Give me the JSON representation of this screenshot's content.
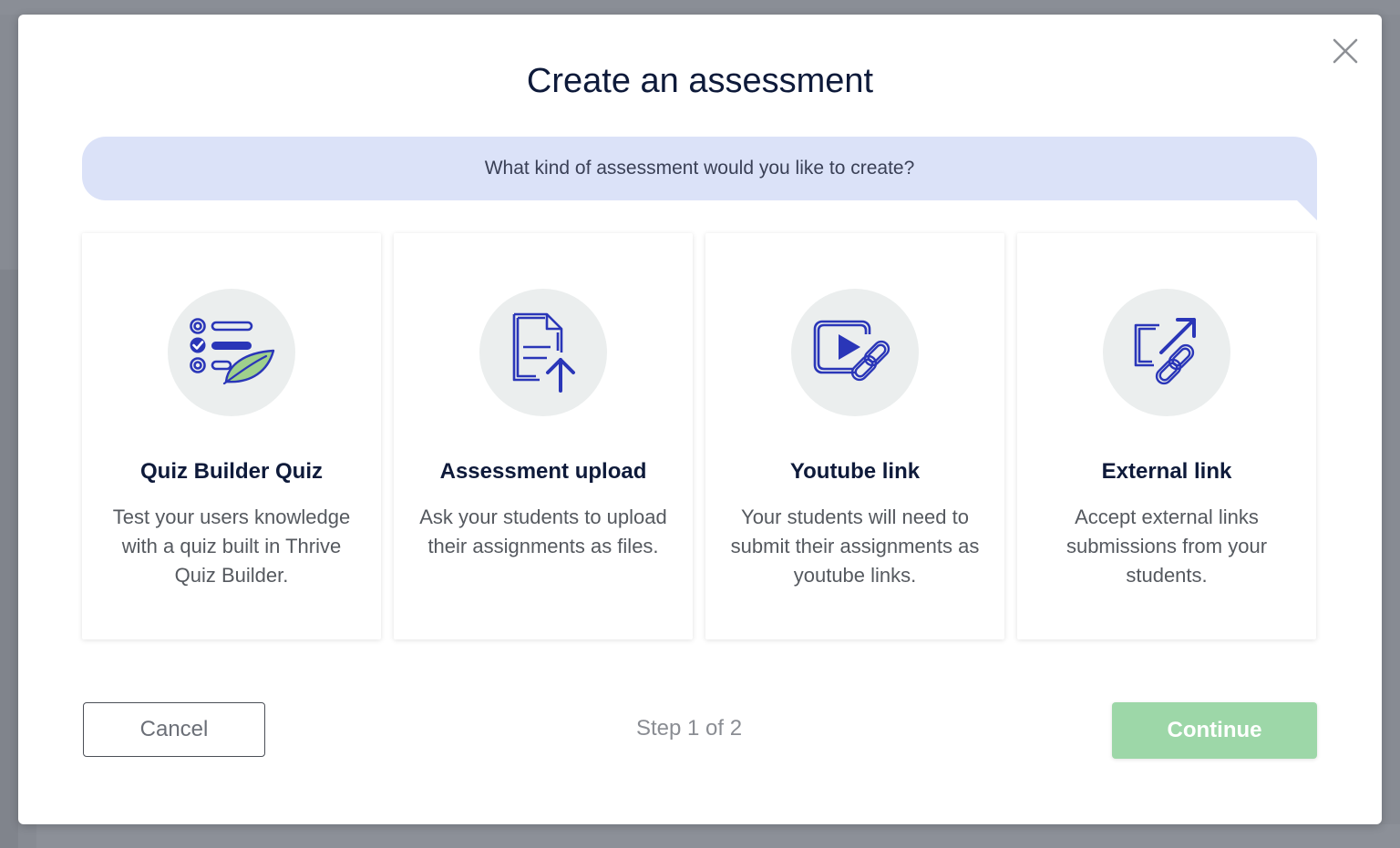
{
  "modal": {
    "title": "Create an assessment",
    "prompt": "What kind of assessment would you like to create?",
    "close_icon": "close-icon"
  },
  "cards": [
    {
      "title": "Quiz Builder Quiz",
      "description": "Test your users knowledge with a quiz built in Thrive Quiz Builder.",
      "icon": "quiz-checklist-icon"
    },
    {
      "title": "Assessment upload",
      "description": "Ask your students to upload their assignments as files.",
      "icon": "file-upload-icon"
    },
    {
      "title": "Youtube link",
      "description": "Your students will need to submit their assignments as youtube links.",
      "icon": "video-link-icon"
    },
    {
      "title": "External link",
      "description": "Accept external links submissions from your students.",
      "icon": "external-link-icon"
    }
  ],
  "footer": {
    "cancel_label": "Cancel",
    "step_text": "Step 1 of 2",
    "continue_label": "Continue"
  },
  "colors": {
    "icon_primary": "#2a36b8",
    "icon_circle_bg": "#ebeeee",
    "prompt_bg": "#dbe2f8",
    "continue_bg": "#9dd7a8",
    "leaf_green": "#9fd08c"
  }
}
